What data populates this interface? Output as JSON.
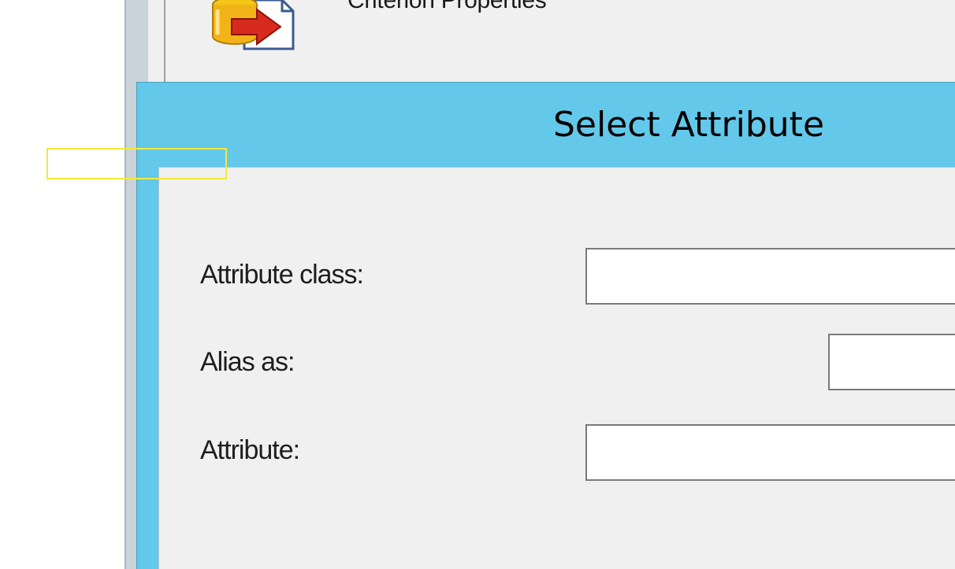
{
  "background_window": {
    "title": "Criterion Properties",
    "icon": "database-export-icon"
  },
  "dialog": {
    "title": "Select Attribute",
    "fields": {
      "attribute_class": {
        "label": "Attribute class:",
        "value": ""
      },
      "alias_as": {
        "label": "Alias as:",
        "value": ""
      },
      "attribute": {
        "label": "Attribute:",
        "value": ""
      }
    }
  },
  "colors": {
    "dialog_frame": "#63c8e9",
    "dialog_body": "#f0f0f0",
    "highlight": "#f2ea3a"
  }
}
